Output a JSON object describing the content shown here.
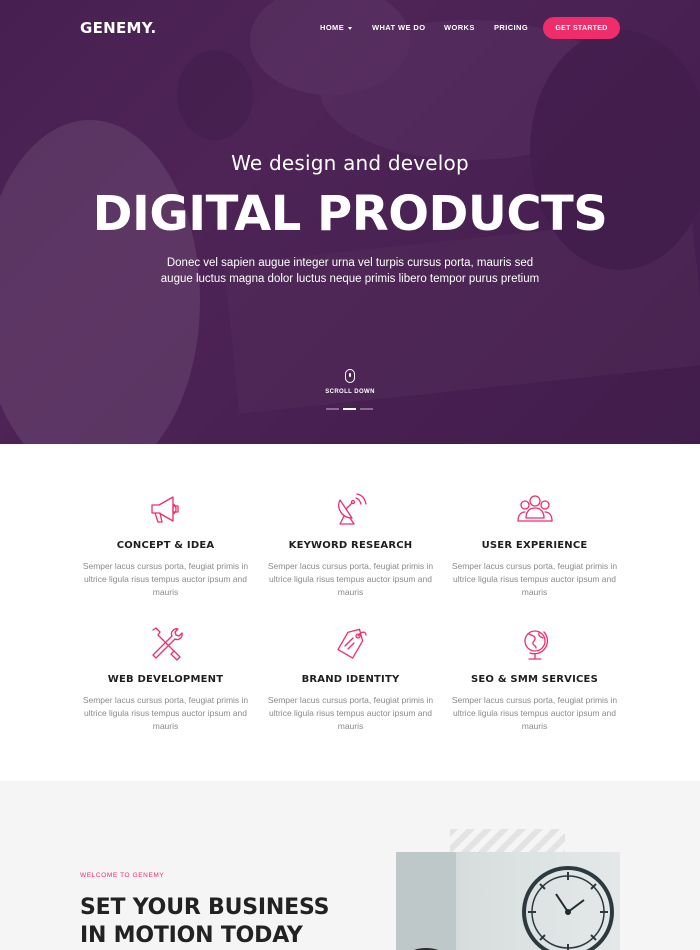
{
  "colors": {
    "accent": "#ef2d6a",
    "hero_overlay": "#4a2552",
    "dark_text": "#1f1f1f",
    "muted_text": "#8a8a8a"
  },
  "nav": {
    "logo": "GENEMY.",
    "items": [
      {
        "label": "HOME",
        "has_dropdown": true
      },
      {
        "label": "WHAT WE DO"
      },
      {
        "label": "WORKS"
      },
      {
        "label": "PRICING"
      }
    ],
    "cta": "GET STARTED"
  },
  "hero": {
    "subtitle": "We design and develop",
    "title": "DIGITAL PRODUCTS",
    "text": "Donec vel sapien augue integer urna vel turpis cursus porta, mauris sed augue luctus magna dolor luctus neque primis libero tempor purus pretium",
    "scroll_label": "SCROLL DOWN",
    "slides": 3,
    "active_slide": 2
  },
  "features": [
    {
      "icon": "megaphone-icon",
      "title": "CONCEPT & IDEA",
      "text": "Semper lacus cursus porta, feugiat primis in ultrice ligula risus tempus auctor ipsum and mauris"
    },
    {
      "icon": "satellite-dish-icon",
      "title": "KEYWORD RESEARCH",
      "text": "Semper lacus cursus porta, feugiat primis in ultrice ligula risus tempus auctor ipsum and mauris"
    },
    {
      "icon": "users-icon",
      "title": "USER EXPERIENCE",
      "text": "Semper lacus cursus porta, feugiat primis in ultrice ligula risus tempus auctor ipsum and mauris"
    },
    {
      "icon": "tools-icon",
      "title": "WEB DEVELOPMENT",
      "text": "Semper lacus cursus porta, feugiat primis in ultrice ligula risus tempus auctor ipsum and mauris"
    },
    {
      "icon": "price-tag-icon",
      "title": "BRAND IDENTITY",
      "text": "Semper lacus cursus porta, feugiat primis in ultrice ligula risus tempus auctor ipsum and mauris"
    },
    {
      "icon": "globe-icon",
      "title": "SEO & SMM SERVICES",
      "text": "Semper lacus cursus porta, feugiat primis in ultrice ligula risus tempus auctor ipsum and mauris"
    }
  ],
  "about": {
    "eyebrow": "WELCOME TO GENEMY",
    "title_line1": "SET YOUR BUSINESS",
    "title_line2": "IN MOTION TODAY",
    "image": "clock-photo"
  }
}
